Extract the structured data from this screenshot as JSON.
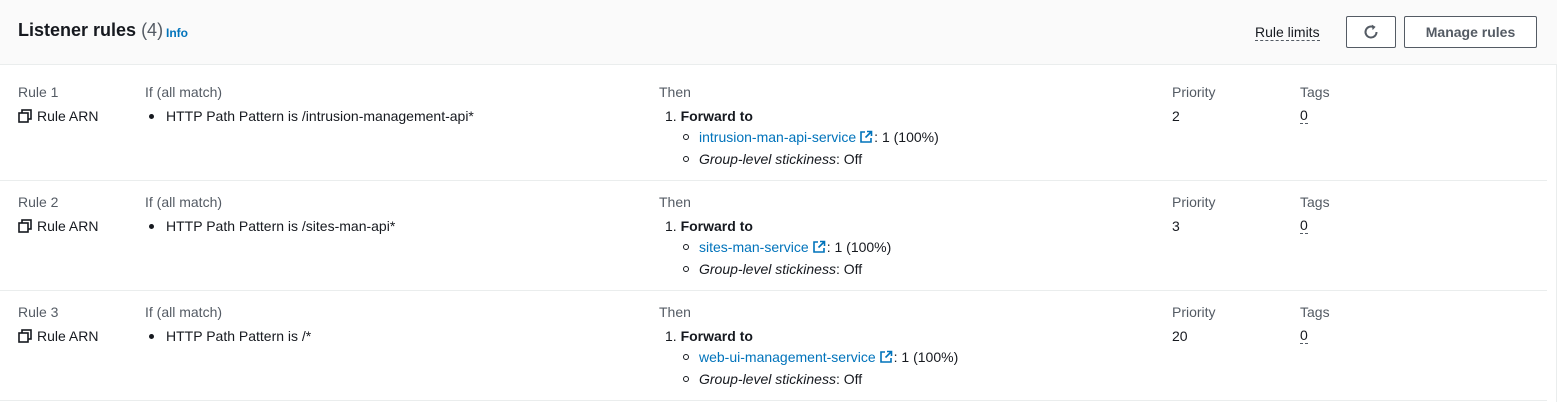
{
  "header": {
    "title": "Listener rules",
    "count": "(4)",
    "info": "Info",
    "rule_limits": "Rule limits",
    "manage_rules": "Manage rules"
  },
  "columns": {
    "if_label": "If (all match)",
    "then_label": "Then",
    "priority_label": "Priority",
    "tags_label": "Tags",
    "arn_label": "Rule ARN"
  },
  "rules": [
    {
      "name": "Rule 1",
      "condition": "HTTP Path Pattern is /intrusion-management-api*",
      "action_num": "1.",
      "action": "Forward to",
      "target": "intrusion-man-api-service",
      "weight": ": 1 (100%)",
      "stickiness_label": "Group-level stickiness",
      "stickiness_value": ": Off",
      "priority": "2",
      "tags": "0"
    },
    {
      "name": "Rule 2",
      "condition": "HTTP Path Pattern is /sites-man-api*",
      "action_num": "1.",
      "action": "Forward to",
      "target": "sites-man-service",
      "weight": ": 1 (100%)",
      "stickiness_label": "Group-level stickiness",
      "stickiness_value": ": Off",
      "priority": "3",
      "tags": "0"
    },
    {
      "name": "Rule 3",
      "condition": "HTTP Path Pattern is /*",
      "action_num": "1.",
      "action": "Forward to",
      "target": "web-ui-management-service",
      "weight": ": 1 (100%)",
      "stickiness_label": "Group-level stickiness",
      "stickiness_value": ": Off",
      "priority": "20",
      "tags": "0"
    }
  ],
  "icons": {
    "refresh": "refresh-icon",
    "copy": "copy-icon",
    "external": "external-link-icon"
  },
  "colors": {
    "link": "#0073bb",
    "text": "#16191f",
    "muted": "#545b64",
    "header_bg": "#fafafa",
    "divider": "#eaeded"
  }
}
